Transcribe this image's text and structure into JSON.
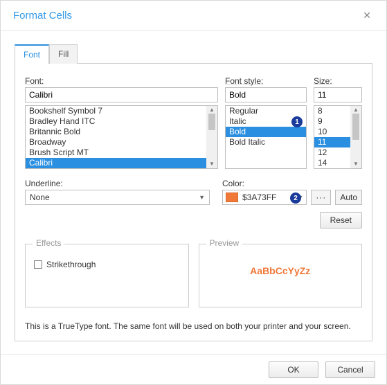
{
  "dialog": {
    "title": "Format Cells",
    "close_glyph": "✕"
  },
  "tabs": [
    {
      "label": "Font",
      "active": true
    },
    {
      "label": "Fill",
      "active": false
    }
  ],
  "labels": {
    "font": "Font:",
    "font_style": "Font style:",
    "size": "Size:",
    "underline": "Underline:",
    "color": "Color:",
    "effects": "Effects",
    "preview": "Preview",
    "strikethrough": "Strikethrough"
  },
  "font": {
    "value": "Calibri",
    "options": [
      "Bookshelf Symbol 7",
      "Bradley Hand ITC",
      "Britannic Bold",
      "Broadway",
      "Brush Script MT",
      "Calibri"
    ],
    "selected_index": 5
  },
  "font_style": {
    "value": "Bold",
    "options": [
      "Regular",
      "Italic",
      "Bold",
      "Bold Italic"
    ],
    "selected_index": 2
  },
  "size": {
    "value": "11",
    "options": [
      "8",
      "9",
      "10",
      "11",
      "12",
      "14"
    ],
    "selected_index": 3
  },
  "underline": {
    "value": "None"
  },
  "color": {
    "hex": "$3A73FF",
    "swatch": "#f07838"
  },
  "buttons": {
    "auto": "Auto",
    "reset": "Reset",
    "ok": "OK",
    "cancel": "Cancel",
    "more": "···"
  },
  "preview_text": "AaBbCcYyZz",
  "footnote": "This is a TrueType font. The same font will be used on both your printer and your screen.",
  "callouts": {
    "a": "1",
    "b": "2"
  }
}
